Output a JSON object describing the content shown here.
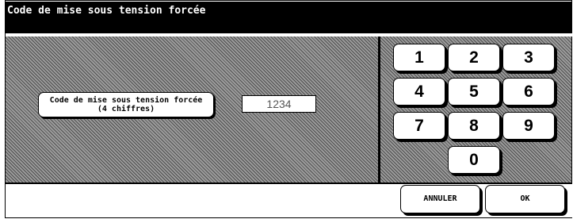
{
  "title": "Code de mise sous tension forcée",
  "field_label_line1": "Code de mise sous tension forcée",
  "field_label_line2": "(4 chiffres)",
  "code_value": "1234",
  "keypad": [
    "1",
    "2",
    "3",
    "4",
    "5",
    "6",
    "7",
    "8",
    "9",
    "0"
  ],
  "buttons": {
    "cancel": "ANNULER",
    "ok": "OK"
  }
}
